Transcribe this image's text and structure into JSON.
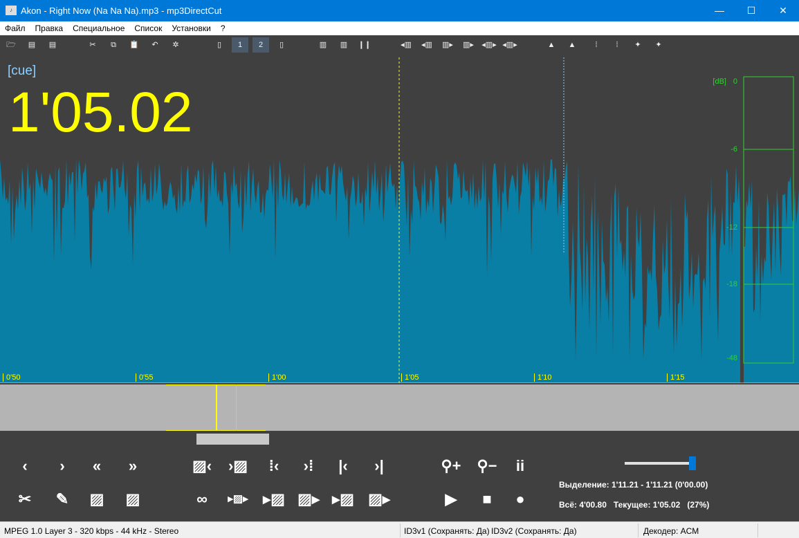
{
  "window": {
    "title": "Akon - Right Now (Na Na Na).mp3 - mp3DirectCut",
    "icon": "mp3-app-icon",
    "minimize": "—",
    "maximize": "☐",
    "close": "✕"
  },
  "menu": [
    "Файл",
    "Правка",
    "Специальное",
    "Список",
    "Установки",
    "?"
  ],
  "toolbar": [
    {
      "icon": "open-icon",
      "glyph": "🗁"
    },
    {
      "icon": "save-icon",
      "glyph": "▤"
    },
    {
      "icon": "save-list-icon",
      "glyph": "▤"
    },
    {
      "icon": "cut-icon",
      "glyph": "✂"
    },
    {
      "icon": "copy-icon",
      "glyph": "⧉"
    },
    {
      "icon": "paste-icon",
      "glyph": "📋"
    },
    {
      "icon": "undo-icon",
      "glyph": "↶"
    },
    {
      "icon": "settings-icon",
      "glyph": "✲"
    },
    {
      "icon": "page-icon",
      "glyph": "▯"
    },
    {
      "icon": "page-1-icon",
      "glyph": "1"
    },
    {
      "icon": "page-2-icon",
      "glyph": "2"
    },
    {
      "icon": "page-info-icon",
      "glyph": "▯"
    },
    {
      "icon": "split-all-icon",
      "glyph": "▥"
    },
    {
      "icon": "split-icon",
      "glyph": "▥"
    },
    {
      "icon": "pause-marks-icon",
      "glyph": "❙❙"
    },
    {
      "icon": "cue-prev-icon",
      "glyph": "◂▥"
    },
    {
      "icon": "cue-prev2-icon",
      "glyph": "◂▥"
    },
    {
      "icon": "cue-next-icon",
      "glyph": "▥▸"
    },
    {
      "icon": "cue-next2-icon",
      "glyph": "▥▸"
    },
    {
      "icon": "cue-both-icon",
      "glyph": "◂▥▸"
    },
    {
      "icon": "cue-both2-icon",
      "glyph": "◂▥▸"
    },
    {
      "icon": "level-up-icon",
      "glyph": "▲"
    },
    {
      "icon": "level-down-icon",
      "glyph": "▲"
    },
    {
      "icon": "fade-in-icon",
      "glyph": "⁞"
    },
    {
      "icon": "fade-out-icon",
      "glyph": "⁞"
    },
    {
      "icon": "marker-icon",
      "glyph": "✦"
    },
    {
      "icon": "marker2-icon",
      "glyph": "✦"
    }
  ],
  "wave": {
    "cue_label": "[cue]",
    "position": "1'05.02",
    "timeline": [
      "0'50",
      "0'55",
      "1'00",
      "1'05",
      "1'10",
      "1'15"
    ],
    "wave_color": "#0a7fa6",
    "cursor_color": "#ffff00",
    "selection_color": "#8ecfff"
  },
  "meter": {
    "unit": "[dB]",
    "levels": [
      "0",
      "-6",
      "-12",
      "-18",
      "-48"
    ],
    "color": "#2fd22f"
  },
  "controls": {
    "row1": [
      {
        "icon": "prev-icon",
        "glyph": "‹"
      },
      {
        "icon": "next-icon",
        "glyph": "›"
      },
      {
        "icon": "rewind-icon",
        "glyph": "«"
      },
      {
        "icon": "forward-icon",
        "glyph": "»"
      },
      {
        "icon": "sel-start-left-icon",
        "glyph": "▨‹"
      },
      {
        "icon": "sel-end-right-icon",
        "glyph": "›▨"
      },
      {
        "icon": "cue-left-icon",
        "glyph": "⁞‹"
      },
      {
        "icon": "cue-right-icon",
        "glyph": "›⁞"
      },
      {
        "icon": "to-start-icon",
        "glyph": "|‹"
      },
      {
        "icon": "to-end-icon",
        "glyph": "›|"
      },
      {
        "icon": "zoom-in-icon",
        "glyph": "⚲+"
      },
      {
        "icon": "zoom-out-icon",
        "glyph": "⚲−"
      },
      {
        "icon": "info-icon",
        "glyph": "ii"
      }
    ],
    "row2": [
      {
        "icon": "scissors-icon",
        "glyph": "✂"
      },
      {
        "icon": "pencil-icon",
        "glyph": "✎"
      },
      {
        "icon": "select-area-icon",
        "glyph": "▨"
      },
      {
        "icon": "select-all-icon",
        "glyph": "▨"
      },
      {
        "icon": "loop-icon",
        "glyph": "∞"
      },
      {
        "icon": "play-selection-icon",
        "glyph": "▸▨▸"
      },
      {
        "icon": "play-to-sel-icon",
        "glyph": "▸▨"
      },
      {
        "icon": "play-from-sel-icon",
        "glyph": "▨▸"
      },
      {
        "icon": "play-to-end-icon",
        "glyph": "▸▨"
      },
      {
        "icon": "play-sel-end-icon",
        "glyph": "▨▸"
      },
      {
        "icon": "play-icon",
        "glyph": "▶"
      },
      {
        "icon": "stop-icon",
        "glyph": "■"
      },
      {
        "icon": "record-icon",
        "glyph": "●"
      }
    ],
    "volume_percent": 100,
    "selection": "Выделение: 1'11.21 - 1'11.21 (0'00.00)",
    "total": "Всё: 4'00.80   Текущее: 1'05.02   (27%)"
  },
  "status": {
    "format": "MPEG 1.0 Layer 3  -  320 kbps  -  44 kHz  -  Stereo",
    "id3v1": "ID3v1 (Сохранять: Да)",
    "id3v2": "ID3v2 (Сохранять: Да)",
    "decoder": "Декодер: ACM"
  }
}
